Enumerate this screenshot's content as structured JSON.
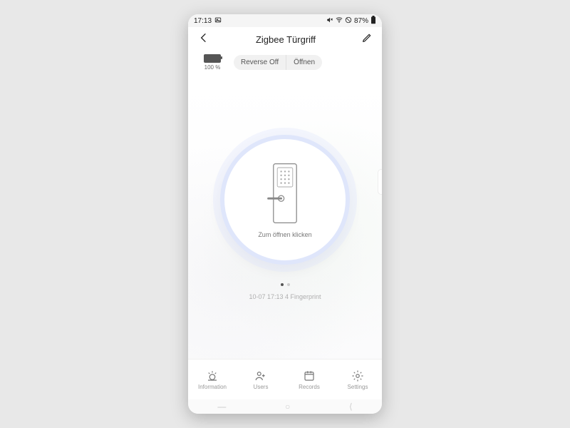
{
  "status_bar": {
    "time": "17:13",
    "battery_percent": "87%"
  },
  "header": {
    "title": "Zigbee Türgriff"
  },
  "device_status": {
    "battery_level": "100 %",
    "toggle_left": "Reverse Off",
    "toggle_right": "Öffnen"
  },
  "lock": {
    "caption": "Zum öffnen klicken"
  },
  "log": {
    "line": "10-07 17:13  4 Fingerprint"
  },
  "tabs": {
    "information": "Information",
    "users": "Users",
    "records": "Records",
    "settings": "Settings"
  }
}
